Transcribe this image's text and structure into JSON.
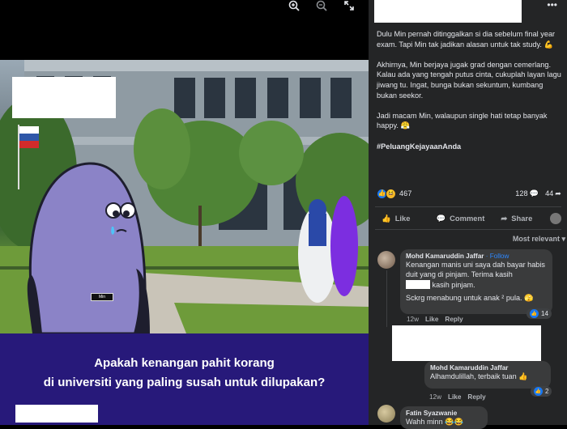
{
  "viewer": {
    "tools": [
      "zoom-in-icon",
      "zoom-out-icon",
      "fullscreen-icon"
    ],
    "name_tag": "Min",
    "banner_line1": "Apakah kenangan pahit korang",
    "banner_line2": "di universiti yang paling susah untuk dilupakan?"
  },
  "post": {
    "paragraph1": "Dulu Min pernah ditinggalkan si dia sebelum final year exam. Tapi Min tak jadikan alasan untuk tak study. 💪",
    "paragraph2": "Akhirnya, Min berjaya jugak grad dengan cemerlang. Kalau ada yang tengah putus cinta, cukuplah layan lagu jiwang tu. Ingat, bunga bukan sekuntum, kumbang bukan seekor.",
    "paragraph3": "Jadi macam Min, walaupun single hati tetap banyak happy. 😤",
    "hashtag": "#PeluangKejayaanAnda",
    "reaction_count": "467",
    "comment_count": "128",
    "share_count": "44"
  },
  "actions": {
    "like": "Like",
    "comment": "Comment",
    "share": "Share"
  },
  "sort_label": "Most relevant",
  "comments": [
    {
      "author": "Mohd Kamaruddin Jaffar",
      "follow": "· Follow",
      "line1": "Kenangan manis uni saya dah bayar habis duit yang di pinjam. Terima kasih",
      "line2": "kasih pinjam.",
      "line3": "Sckrg menabung untuk anak ² pula. 🫣",
      "time": "12w",
      "like": "Like",
      "reply": "Reply",
      "reactions": "14"
    },
    {
      "author": "Mohd Kamaruddin Jaffar",
      "body": "Alhamdulillah, terbaik tuan 👍",
      "time": "12w",
      "like": "Like",
      "reply": "Reply",
      "reactions": "2"
    },
    {
      "author": "Fatin Syazwanie",
      "body": "Wahh minn 😂😂"
    }
  ],
  "colors": {
    "banner": "#27197a",
    "sidebar": "#242526",
    "bubble": "#3a3b3c",
    "accent": "#2d88ff"
  }
}
